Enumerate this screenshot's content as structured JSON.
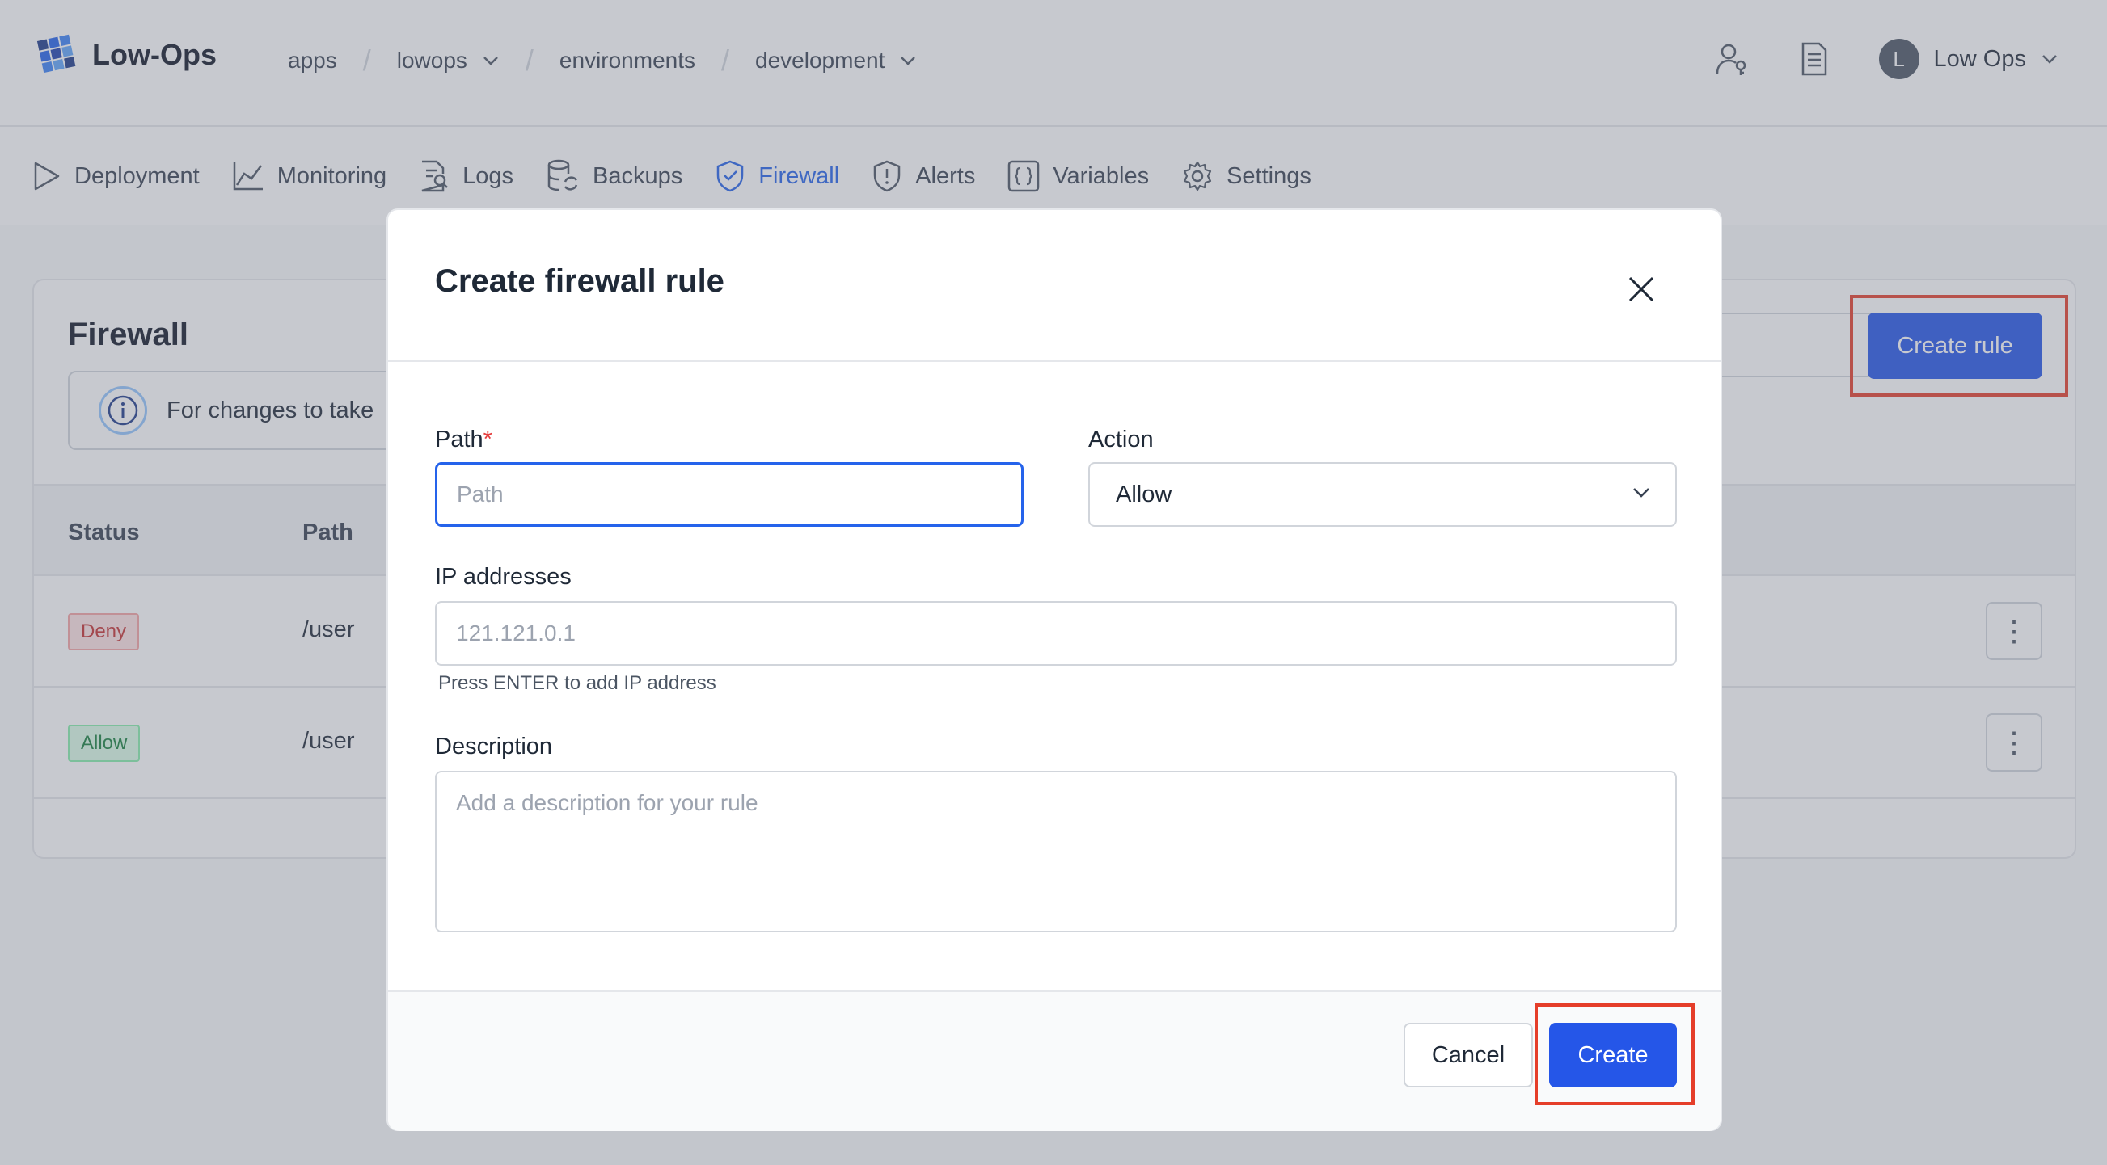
{
  "header": {
    "logo_text": "Low-Ops",
    "breadcrumbs": [
      "apps",
      "lowops",
      "environments",
      "development"
    ],
    "user_initial": "L",
    "user_name": "Low Ops"
  },
  "tabs": [
    {
      "label": "Deployment",
      "icon": "play-icon"
    },
    {
      "label": "Monitoring",
      "icon": "chart-icon"
    },
    {
      "label": "Logs",
      "icon": "log-file-icon"
    },
    {
      "label": "Backups",
      "icon": "database-icon"
    },
    {
      "label": "Firewall",
      "icon": "shield-icon",
      "active": true
    },
    {
      "label": "Alerts",
      "icon": "alert-shield-icon"
    },
    {
      "label": "Variables",
      "icon": "braces-icon"
    },
    {
      "label": "Settings",
      "icon": "gear-icon"
    }
  ],
  "firewall": {
    "title": "Firewall",
    "info_text": "For changes to take",
    "create_rule_label": "Create rule",
    "columns": [
      "Status",
      "Path"
    ],
    "rows": [
      {
        "status": "Deny",
        "path": "/user"
      },
      {
        "status": "Allow",
        "path": "/user"
      }
    ]
  },
  "modal": {
    "title": "Create firewall rule",
    "path_label": "Path",
    "path_required_mark": "*",
    "path_placeholder": "Path",
    "action_label": "Action",
    "action_value": "Allow",
    "ip_label": "IP addresses",
    "ip_placeholder": "121.121.0.1",
    "ip_hint": "Press ENTER to add IP address",
    "description_label": "Description",
    "description_placeholder": "Add a description for your rule",
    "cancel_label": "Cancel",
    "create_label": "Create"
  },
  "colors": {
    "primary": "#2556e8",
    "highlight": "#e53e2a",
    "active_tab": "#2563eb"
  }
}
